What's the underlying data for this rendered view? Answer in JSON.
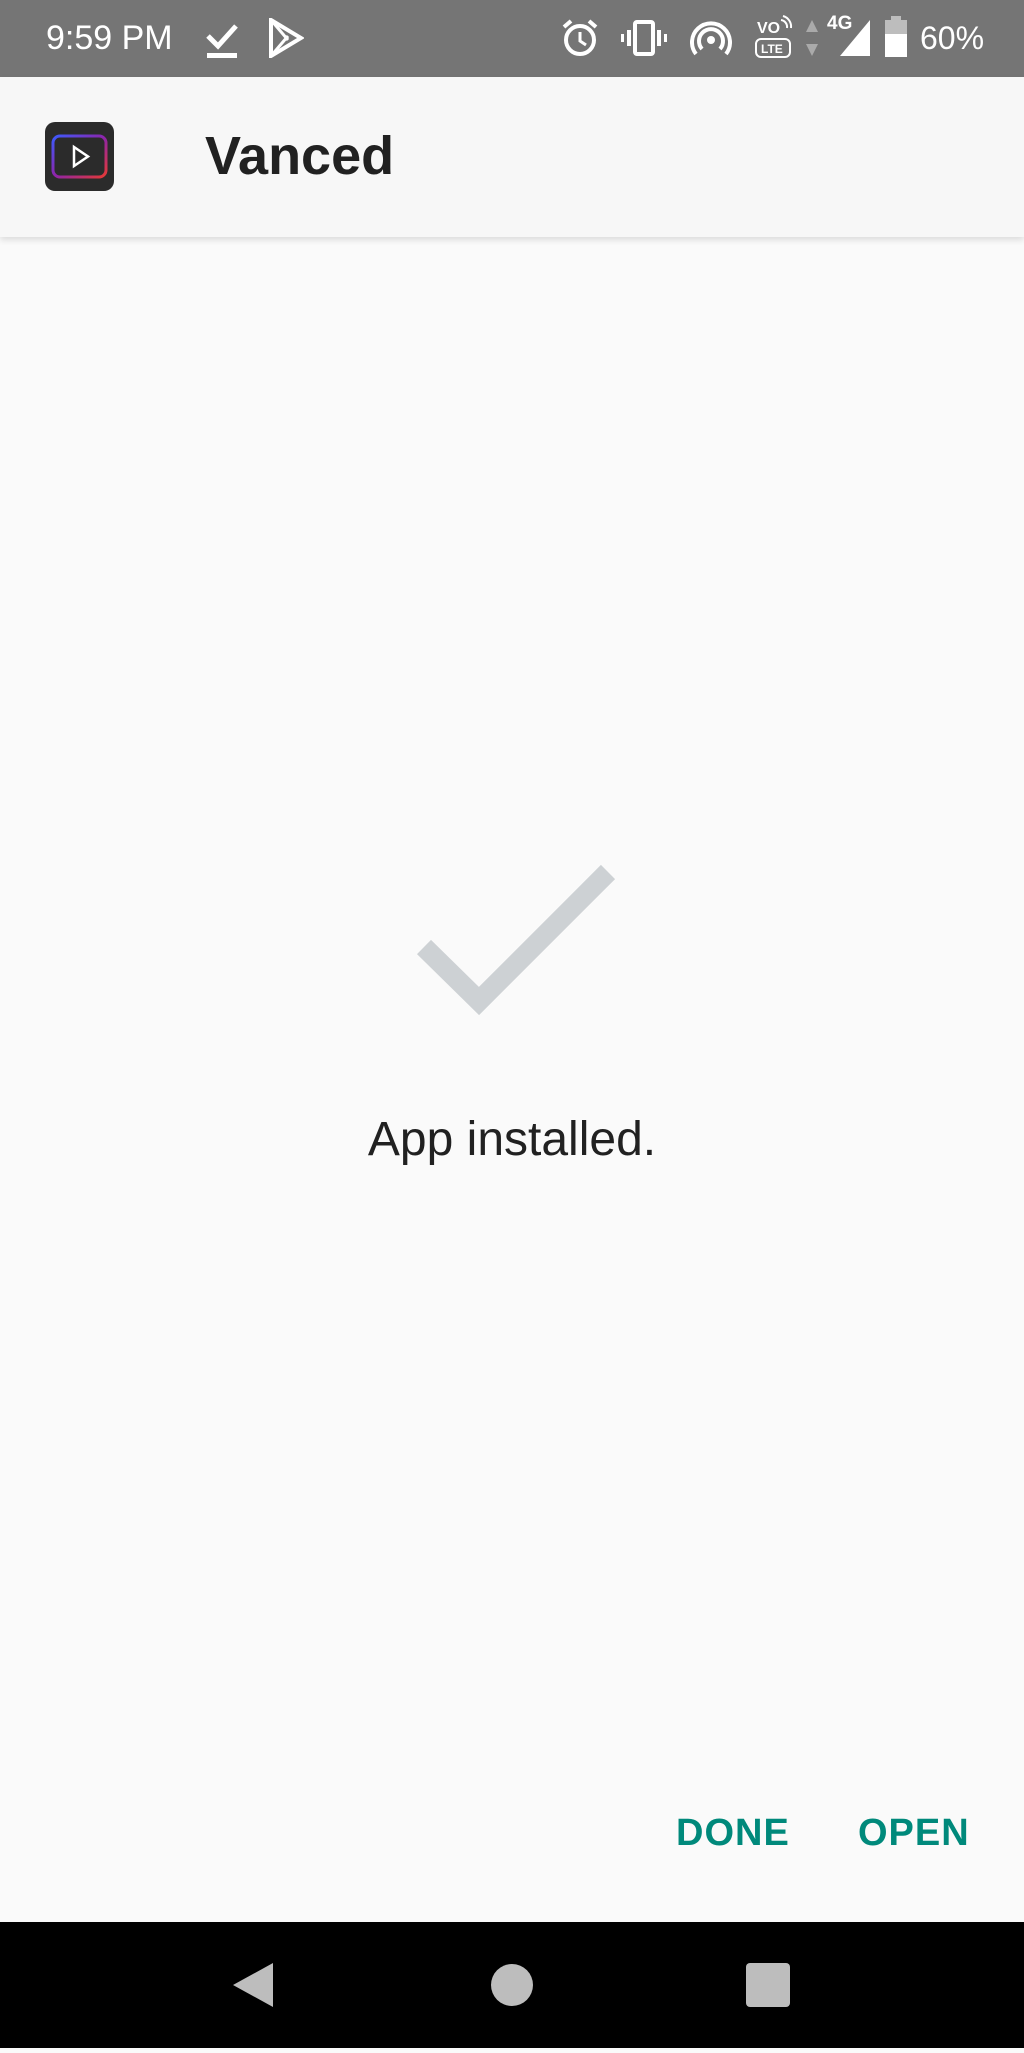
{
  "status_bar": {
    "time": "9:59 PM",
    "network": "4G",
    "battery": "60%",
    "icons": [
      "check-download-icon",
      "play-store-icon",
      "alarm-icon",
      "vibrate-icon",
      "hotspot-icon",
      "volte-icon",
      "data-arrows-icon",
      "signal-icon",
      "battery-icon"
    ]
  },
  "app_bar": {
    "title": "Vanced",
    "icon": "vanced-app-icon"
  },
  "main": {
    "icon": "checkmark-icon",
    "message": "App installed."
  },
  "actions": {
    "done_label": "DONE",
    "open_label": "OPEN"
  },
  "nav_bar": {
    "icons": [
      "back-icon",
      "home-icon",
      "recents-icon"
    ]
  },
  "colors": {
    "status_bar": "#757575",
    "accent": "#00897b",
    "checkmark": "#cdd1d4",
    "background": "#fafafa"
  }
}
